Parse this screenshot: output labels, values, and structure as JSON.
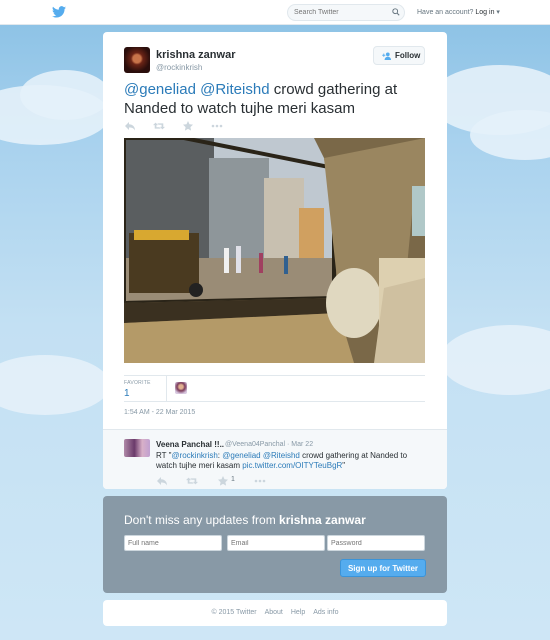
{
  "topbar": {
    "logo_icon": "twitter-bird-icon",
    "brand_color": "#55acee",
    "search_placeholder": "Search Twitter",
    "login_prefix": "Have an account?",
    "login_label": "Log in"
  },
  "tweet": {
    "fullname": "krishna zanwar",
    "screenname": "@rockinkrish",
    "follow_label": "Follow",
    "text_mention_1": "@geneliad",
    "text_mention_2": "@Riteishd",
    "text_rest": " crowd gathering at Nanded to watch tujhe meri kasam",
    "actions": [
      "reply-icon",
      "retweet-icon",
      "favorite-icon",
      "more-icon"
    ],
    "favorites_label": "FAVORITE",
    "favorites_count": "1",
    "timestamp": "1:54 AM - 22 Mar 2015"
  },
  "reply": {
    "fullname": "Veena Panchal !!..",
    "screenname": "@Veena04Panchal",
    "time": "Mar 22",
    "prefix": "RT \"",
    "mention_1": "@rockinkrish",
    "sep": ": ",
    "mention_2": "@geneliad",
    "mention_3": "@Riteishd",
    "rest": " crowd gathering at Nanded to watch tujhe meri kasam ",
    "link": "pic.twitter.com/OITYTeuBgR",
    "suffix": "\"",
    "fav_count": "1"
  },
  "signup": {
    "title_prefix": "Don't miss any updates from ",
    "title_name": "krishna zanwar",
    "fullname_placeholder": "Full name",
    "email_placeholder": "Email",
    "password_placeholder": "Password",
    "button_label": "Sign up for Twitter"
  },
  "footer": {
    "copyright": "© 2015 Twitter",
    "about": "About",
    "help": "Help",
    "ads": "Ads info"
  }
}
